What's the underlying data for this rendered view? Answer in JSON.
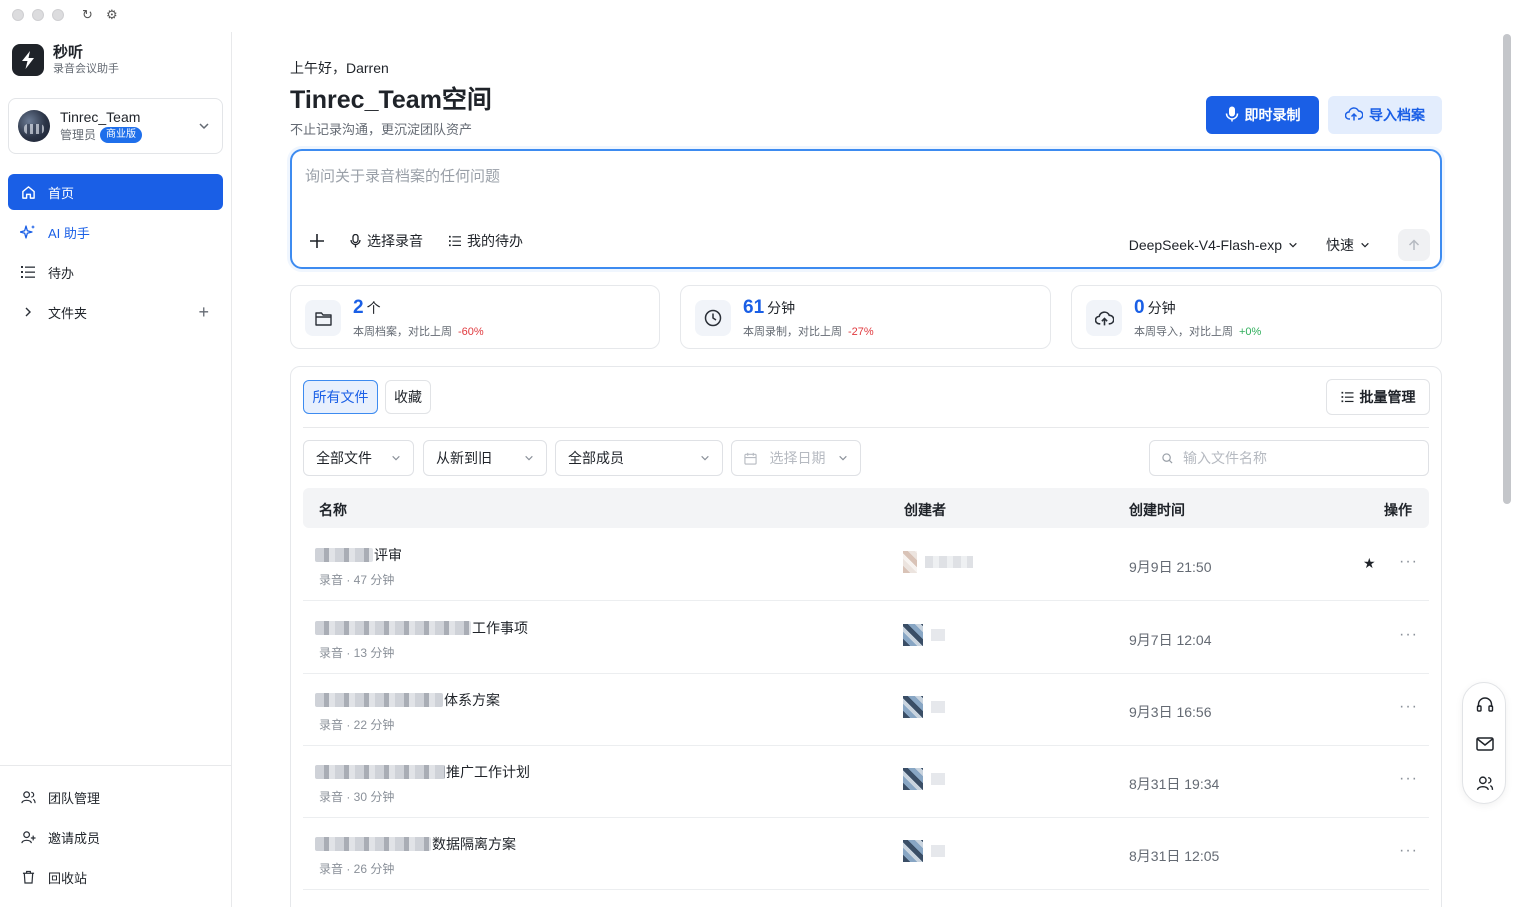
{
  "app": {
    "name": "秒听",
    "subtitle": "录音会议助手"
  },
  "team": {
    "name": "Tinrec_Team",
    "role": "管理员",
    "plan": "商业版"
  },
  "nav": [
    {
      "label": "首页",
      "icon": "home-icon"
    },
    {
      "label": "AI 助手",
      "icon": "sparkle-icon"
    },
    {
      "label": "待办",
      "icon": "list-icon"
    },
    {
      "label": "文件夹",
      "icon": "chevron-right-icon"
    }
  ],
  "bottom_nav": [
    {
      "label": "团队管理",
      "icon": "team-icon"
    },
    {
      "label": "邀请成员",
      "icon": "invite-icon"
    },
    {
      "label": "回收站",
      "icon": "trash-icon"
    }
  ],
  "header": {
    "greeting": "上午好，Darren",
    "title": "Tinrec_Team空间",
    "subtitle": "不止记录沟通，更沉淀团队资产",
    "record_label": "即时录制",
    "import_label": "导入档案"
  },
  "ask": {
    "placeholder": "询问关于录音档案的任何问题",
    "select_recording": "选择录音",
    "my_todos": "我的待办",
    "model": "DeepSeek-V4-Flash-exp",
    "mode": "快速"
  },
  "stats": [
    {
      "value": "2",
      "unit": "个",
      "desc": "本周档案，对比上周",
      "change": "-60%",
      "trend": "down"
    },
    {
      "value": "61",
      "unit": "分钟",
      "desc": "本周录制，对比上周",
      "change": "-27%",
      "trend": "down"
    },
    {
      "value": "0",
      "unit": "分钟",
      "desc": "本周导入，对比上周",
      "change": "+0%",
      "trend": "up"
    }
  ],
  "files": {
    "tabs": [
      "所有文件",
      "收藏"
    ],
    "batch_label": "批量管理",
    "filters": {
      "type": "全部文件",
      "sort": "从新到旧",
      "member": "全部成员",
      "date": "选择日期"
    },
    "search_placeholder": "输入文件名称",
    "columns": [
      "名称",
      "创建者",
      "创建时间",
      "操作"
    ],
    "rows": [
      {
        "name_suffix": "评审",
        "meta": "录音 · 47 分钟",
        "time": "9月9日 21:50",
        "starred": true
      },
      {
        "name_suffix": "工作事项",
        "meta": "录音 · 13 分钟",
        "time": "9月7日 12:04",
        "starred": false
      },
      {
        "name_suffix": "体系方案",
        "meta": "录音 · 22 分钟",
        "time": "9月3日 16:56",
        "starred": false
      },
      {
        "name_suffix": "推广工作计划",
        "meta": "录音 · 30 分钟",
        "time": "8月31日 19:34",
        "starred": false
      },
      {
        "name_suffix": "数据隔离方案",
        "meta": "录音 · 26 分钟",
        "time": "8月31日 12:05",
        "starred": false
      }
    ]
  },
  "colors": {
    "primary": "#1a5fe6",
    "negative": "#e0393e",
    "positive": "#2fae5b"
  }
}
